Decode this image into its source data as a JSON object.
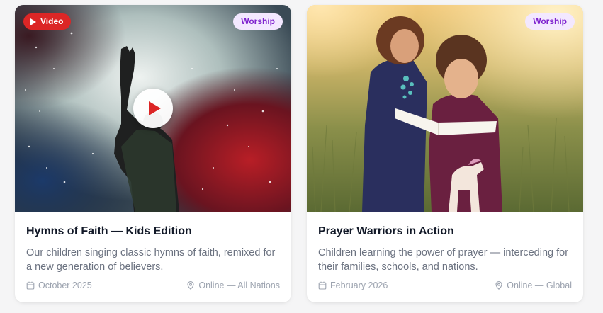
{
  "cards": [
    {
      "video_label": "Video",
      "tag": "Worship",
      "title": "Hymns of Faith — Kids Edition",
      "description": "Our children singing classic hymns of faith, remixed for a new generation of believers.",
      "date": "October 2025",
      "location": "Online — All Nations"
    },
    {
      "tag": "Worship",
      "title": "Prayer Warriors in Action",
      "description": "Children learning the power of prayer — interceding for their families, schools, and nations.",
      "date": "February 2026",
      "location": "Online — Global"
    }
  ],
  "colors": {
    "video_badge": "#dc2626",
    "tag_bg": "#f3e8ff",
    "tag_text": "#7e22ce",
    "title": "#111827",
    "description": "#6b7280",
    "meta": "#9ca3af"
  },
  "icons": [
    "play-icon",
    "calendar-icon",
    "map-pin-icon"
  ]
}
